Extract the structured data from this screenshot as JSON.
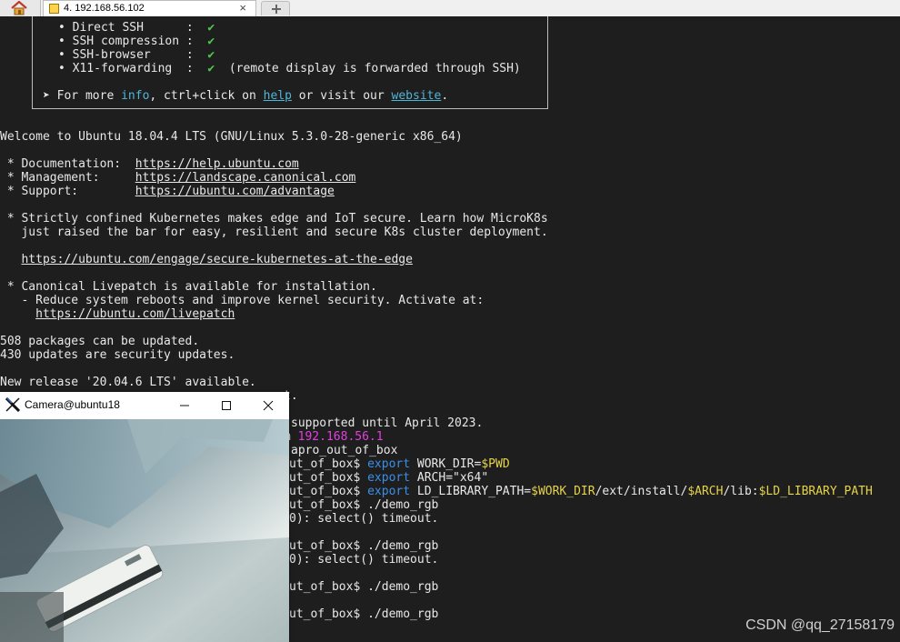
{
  "tabs": {
    "home_icon": "home-icon",
    "session_label": "4. 192.168.56.102",
    "close_glyph": "×",
    "new_tab_icon": "new-tab-icon"
  },
  "banner": {
    "bullet": "•",
    "features": [
      {
        "name": "Direct SSH      ",
        "sep": ":",
        "status": "✔",
        "note": ""
      },
      {
        "name": "SSH compression ",
        "sep": ":",
        "status": "✔",
        "note": ""
      },
      {
        "name": "SSH-browser     ",
        "sep": ":",
        "status": "✔",
        "note": ""
      },
      {
        "name": "X11-forwarding  ",
        "sep": ":",
        "status": "✔",
        "note": "(remote display is forwarded through SSH)"
      }
    ],
    "more_prefix": "➤ For more ",
    "more_info": "info",
    "more_mid": ", ctrl+click on ",
    "more_help": "help",
    "more_or": " or visit our ",
    "more_website": "website",
    "more_end": "."
  },
  "motd": {
    "welcome": "Welcome to Ubuntu 18.04.4 LTS (GNU/Linux 5.3.0-28-generic x86_64)",
    "doc_label": " * Documentation:  ",
    "doc_url": "https://help.ubuntu.com",
    "mgmt_label": " * Management:     ",
    "mgmt_url": "https://landscape.canonical.com",
    "support_label": " * Support:        ",
    "support_url": "https://ubuntu.com/advantage",
    "k8s_1": " * Strictly confined Kubernetes makes edge and IoT secure. Learn how MicroK8s",
    "k8s_2": "   just raised the bar for easy, resilient and secure K8s cluster deployment.",
    "k8s_url_indent": "   ",
    "k8s_url": "https://ubuntu.com/engage/secure-kubernetes-at-the-edge",
    "livepatch_1": " * Canonical Livepatch is available for installation.",
    "livepatch_2": "   - Reduce system reboots and improve kernel security. Activate at:",
    "livepatch_url_indent": "     ",
    "livepatch_url": "https://ubuntu.com/livepatch",
    "pkgs": "508 packages can be updated.",
    "security": "430 updates are security updates.",
    "release": "New release '20.04.6 LTS' available."
  },
  "partial": {
    "l1": "t.",
    "l2": "supported until April 2023.",
    "l3_prefix": "m ",
    "l3_ip": "192.168.56.1",
    "l4": "apro_out_of_box",
    "prompt": "ut_of_box$ ",
    "export": "export",
    "cmd1_a": " WORK_DIR=",
    "cmd1_var": "$PWD",
    "cmd2_a": " ARCH=\"x64\"",
    "cmd3_a": " LD_LIBRARY_PATH=",
    "cmd3_v1": "$WORK_DIR",
    "cmd3_b": "/ext/install/",
    "cmd3_v2": "$ARCH",
    "cmd3_c": "/lib:",
    "cmd3_v3": "$LD_LIBRARY_PATH",
    "demo": "./demo_rgb",
    "timeout": "0): select() timeout."
  },
  "camera": {
    "title": "Camera@ubuntu18",
    "app_icon": "x11-logo-icon",
    "min_icon": "minimize-icon",
    "max_icon": "maximize-icon",
    "close_icon": "close-icon"
  },
  "watermark": "CSDN @qq_27158179",
  "colors": {
    "terminal_bg": "#1e1e1e",
    "link_cyan": "#4fb6d8",
    "check_green": "#4ec94e",
    "ip_magenta": "#e040e0",
    "keyword_blue": "#3b8eea",
    "var_yellow": "#e5d34a"
  }
}
